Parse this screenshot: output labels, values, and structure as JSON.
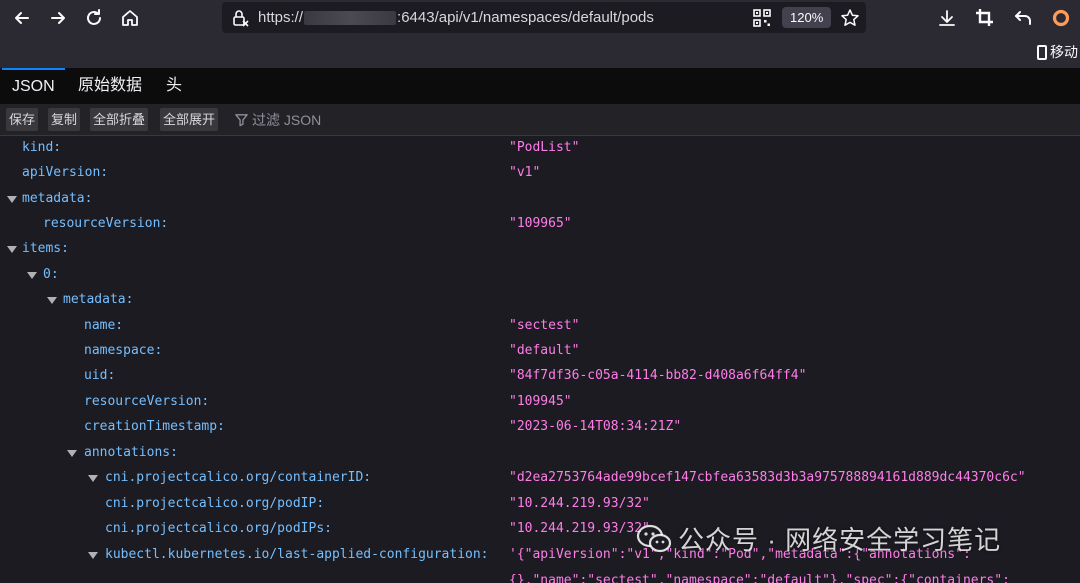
{
  "browser": {
    "url_prefix": "https://",
    "url_suffix": ":6443/api/v1/namespaces/default/pods",
    "zoom": "120%",
    "mobile_label": "移动"
  },
  "tabs": [
    {
      "label": "JSON",
      "active": true
    },
    {
      "label": "原始数据"
    },
    {
      "label": "头"
    }
  ],
  "actions": {
    "save": "保存",
    "copy": "复制",
    "collapse_all": "全部折叠",
    "expand_all": "全部展开",
    "filter_placeholder": "过滤 JSON"
  },
  "tree": [
    {
      "key": "kind:",
      "value": "\"PodList\""
    },
    {
      "key": "apiVersion:",
      "value": "\"v1\""
    },
    {
      "key": "metadata:"
    },
    {
      "key": "resourceVersion:",
      "value": "\"109965\""
    },
    {
      "key": "items:"
    },
    {
      "key": "0:"
    },
    {
      "key": "metadata:"
    },
    {
      "key": "name:",
      "value": "\"sectest\""
    },
    {
      "key": "namespace:",
      "value": "\"default\""
    },
    {
      "key": "uid:",
      "value": "\"84f7df36-c05a-4114-bb82-d408a6f64ff4\""
    },
    {
      "key": "resourceVersion:",
      "value": "\"109945\""
    },
    {
      "key": "creationTimestamp:",
      "value": "\"2023-06-14T08:34:21Z\""
    },
    {
      "key": "annotations:"
    },
    {
      "key": "cni.projectcalico.org/containerID:",
      "value": "\"d2ea2753764ade99bcef147cbfea63583d3b3a975788894161d889dc44370c6c\""
    },
    {
      "key": "cni.projectcalico.org/podIP:",
      "value": "\"10.244.219.93/32\""
    },
    {
      "key": "cni.projectcalico.org/podIPs:",
      "value": "\"10.244.219.93/32\""
    },
    {
      "key": "kubectl.kubernetes.io/last-applied-configuration:",
      "value": "'{\"apiVersion\":\"v1\",\"kind\":\"Pod\",\"metadata\":{\"annotations\":",
      "value2": "{},\"name\":\"sectest\",\"namespace\":\"default\"},\"spec\":{\"containers\":"
    }
  ],
  "watermark": "公众号 · 网络安全学习笔记"
}
